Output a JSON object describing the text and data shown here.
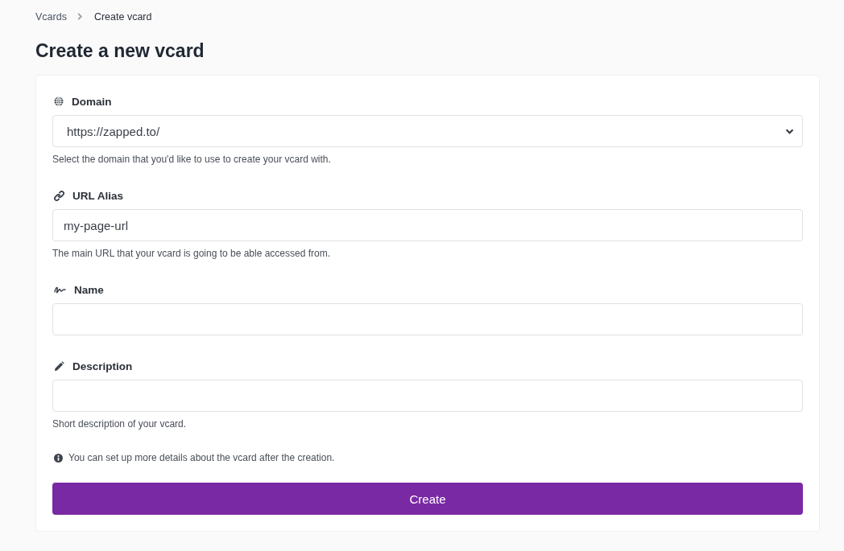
{
  "breadcrumb": [
    {
      "label": "Vcards",
      "kind": "link"
    },
    {
      "label": "Create vcard",
      "kind": "current"
    }
  ],
  "title": "Create a new vcard",
  "fields": [
    {
      "kind": "select",
      "label": "Domain",
      "value": "https://zapped.to/",
      "help": "Select the domain that you'd like to use to create your vcard with."
    },
    {
      "kind": "text",
      "label": "URL Alias",
      "value": "my-page-url",
      "help": "The main URL that your vcard is going to be able accessed from."
    },
    {
      "kind": "text",
      "label": "Name"
    },
    {
      "kind": "text",
      "label": "Description",
      "help": "Short description of your vcard."
    }
  ],
  "note": "You can set up more details about the vcard after the creation.",
  "submit": "Create"
}
